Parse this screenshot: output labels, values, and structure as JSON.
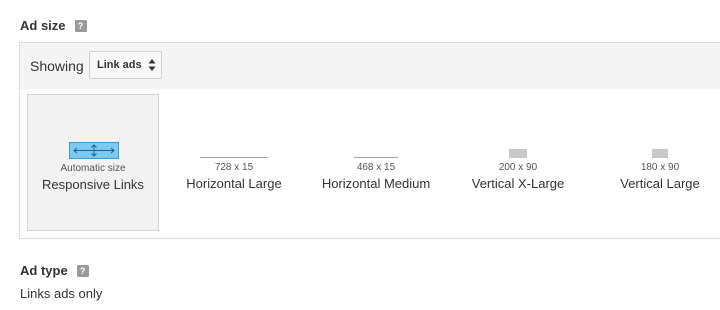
{
  "ad_size": {
    "title": "Ad size",
    "help": "?",
    "showing_label": "Showing",
    "select_value": "Link ads",
    "options": [
      {
        "dim": "Automatic size",
        "name": "Responsive Links",
        "selected": true
      },
      {
        "dim": "728 x 15",
        "name": "Horizontal Large",
        "selected": false
      },
      {
        "dim": "468 x 15",
        "name": "Horizontal Medium",
        "selected": false
      },
      {
        "dim": "200 x 90",
        "name": "Vertical X-Large",
        "selected": false
      },
      {
        "dim": "180 x 90",
        "name": "Vertical Large",
        "selected": false
      }
    ]
  },
  "ad_type": {
    "title": "Ad type",
    "help": "?",
    "value": "Links ads only"
  },
  "colors": {
    "accent_preview": "#7ccaf2",
    "selected_tile_bg": "#f2f2f2"
  }
}
